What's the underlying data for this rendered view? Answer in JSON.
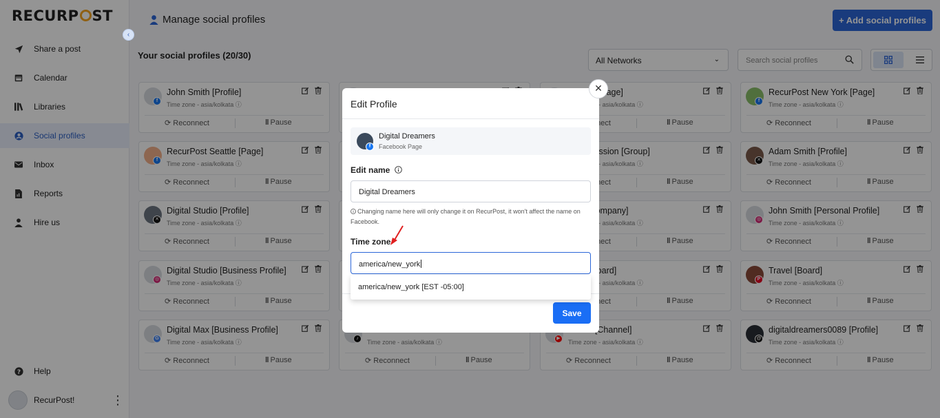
{
  "brand": {
    "logo_text_left": "RECURP",
    "logo_text_right": "ST",
    "accent": "#2b66d8",
    "logo_accent": "#f6a623"
  },
  "sidebar": {
    "items": [
      {
        "label": "Share a post",
        "icon": "send-icon"
      },
      {
        "label": "Calendar",
        "icon": "calendar-icon"
      },
      {
        "label": "Libraries",
        "icon": "library-icon"
      },
      {
        "label": "Social profiles",
        "icon": "user-circle-icon",
        "active": true
      },
      {
        "label": "Inbox",
        "icon": "inbox-icon"
      },
      {
        "label": "Reports",
        "icon": "report-icon"
      },
      {
        "label": "Hire us",
        "icon": "person-icon"
      }
    ],
    "help_label": "Help",
    "user_name": "RecurPost!"
  },
  "header": {
    "title": "Manage social profiles",
    "add_button": "+ Add social profiles"
  },
  "toolbar": {
    "count_label": "Your social profiles (20/30)",
    "network_filter": "All Networks",
    "search_placeholder": "Search social profiles"
  },
  "profiles": [
    {
      "name": "John Smith [Profile]",
      "tz": "Time zone - asia/kolkata",
      "network": "facebook"
    },
    {
      "name": "",
      "tz": "",
      "network": ""
    },
    {
      "name": "Denver [Page]",
      "tz": "Time zone - asia/kolkata",
      "network": ""
    },
    {
      "name": "RecurPost New York [Page]",
      "tz": "Time zone - asia/kolkata",
      "network": "facebook"
    },
    {
      "name": "RecurPost Seattle [Page]",
      "tz": "Time zone - asia/kolkata",
      "network": "facebook"
    },
    {
      "name": "",
      "tz": "",
      "network": ""
    },
    {
      "name": "st Discussion [Group]",
      "tz": "Time zone - asia/kolkata",
      "network": ""
    },
    {
      "name": "Adam Smith [Profile]",
      "tz": "Time zone - asia/kolkata",
      "network": "x"
    },
    {
      "name": "Digital Studio [Profile]",
      "tz": "Time zone - asia/kolkata",
      "network": "x"
    },
    {
      "name": "",
      "tz": "",
      "network": ""
    },
    {
      "name": "Max [Company]",
      "tz": "Time zone - asia/kolkata",
      "network": ""
    },
    {
      "name": "John Smith [Personal Profile]",
      "tz": "Time zone - asia/kolkata",
      "network": "instagram"
    },
    {
      "name": "Digital Studio [Business Profile]",
      "tz": "Time zone - asia/kolkata",
      "network": "instagram"
    },
    {
      "name": "",
      "tz": "",
      "network": ""
    },
    {
      "name": "aves [Board]",
      "tz": "Time zone - asia/kolkata",
      "network": ""
    },
    {
      "name": "Travel [Board]",
      "tz": "Time zone - asia/kolkata",
      "network": "pinterest"
    },
    {
      "name": "Digital Max [Business Profile]",
      "tz": "Time zone - asia/kolkata",
      "network": "google"
    },
    {
      "name": "",
      "tz": "Time zone - asia/kolkata",
      "network": "tiktok"
    },
    {
      "name": "Studio [Channel]",
      "tz": "Time zone - asia/kolkata",
      "network": "youtube"
    },
    {
      "name": "digitaldreamers0089 [Profile]",
      "tz": "Time zone - asia/kolkata",
      "network": "threads"
    }
  ],
  "card_actions": {
    "reconnect": "Reconnect",
    "pause": "Pause",
    "reconnect_partial": "ect"
  },
  "modal": {
    "title": "Edit Profile",
    "page_name": "Digital Dreamers",
    "page_type": "Facebook Page",
    "edit_name_label": "Edit name",
    "name_value": "Digital Dreamers",
    "name_note": "Changing name here will only change it on RecurPost, it won't affect the name on Facebook.",
    "tz_label": "Time zone",
    "tz_value": "america/new_york",
    "tz_option": "america/new_york [EST -05:00]",
    "save_label": "Save"
  }
}
